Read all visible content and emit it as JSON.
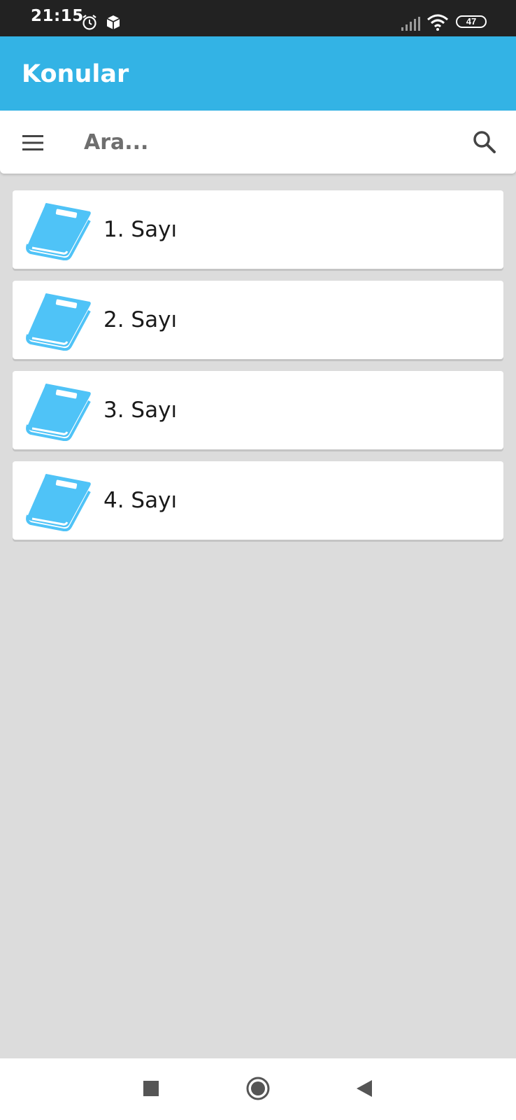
{
  "status_bar": {
    "time": "21:15",
    "battery": "47",
    "icons": [
      "alarm-icon",
      "package-icon",
      "signal-icon",
      "wifi-icon",
      "battery-icon"
    ]
  },
  "app_bar": {
    "title": "Konular",
    "color": "#33b3e5"
  },
  "search": {
    "placeholder": "Ara...",
    "value": "",
    "menu_icon": "hamburger-menu-icon",
    "search_icon": "search-icon"
  },
  "list": {
    "icon": "book-icon",
    "icon_color": "#4fc3f7",
    "items": [
      {
        "label": "1. Sayı"
      },
      {
        "label": "2. Sayı"
      },
      {
        "label": "3. Sayı"
      },
      {
        "label": "4. Sayı"
      }
    ]
  },
  "nav_bar": {
    "buttons": [
      "recents-square-icon",
      "home-circle-icon",
      "back-triangle-icon"
    ]
  }
}
